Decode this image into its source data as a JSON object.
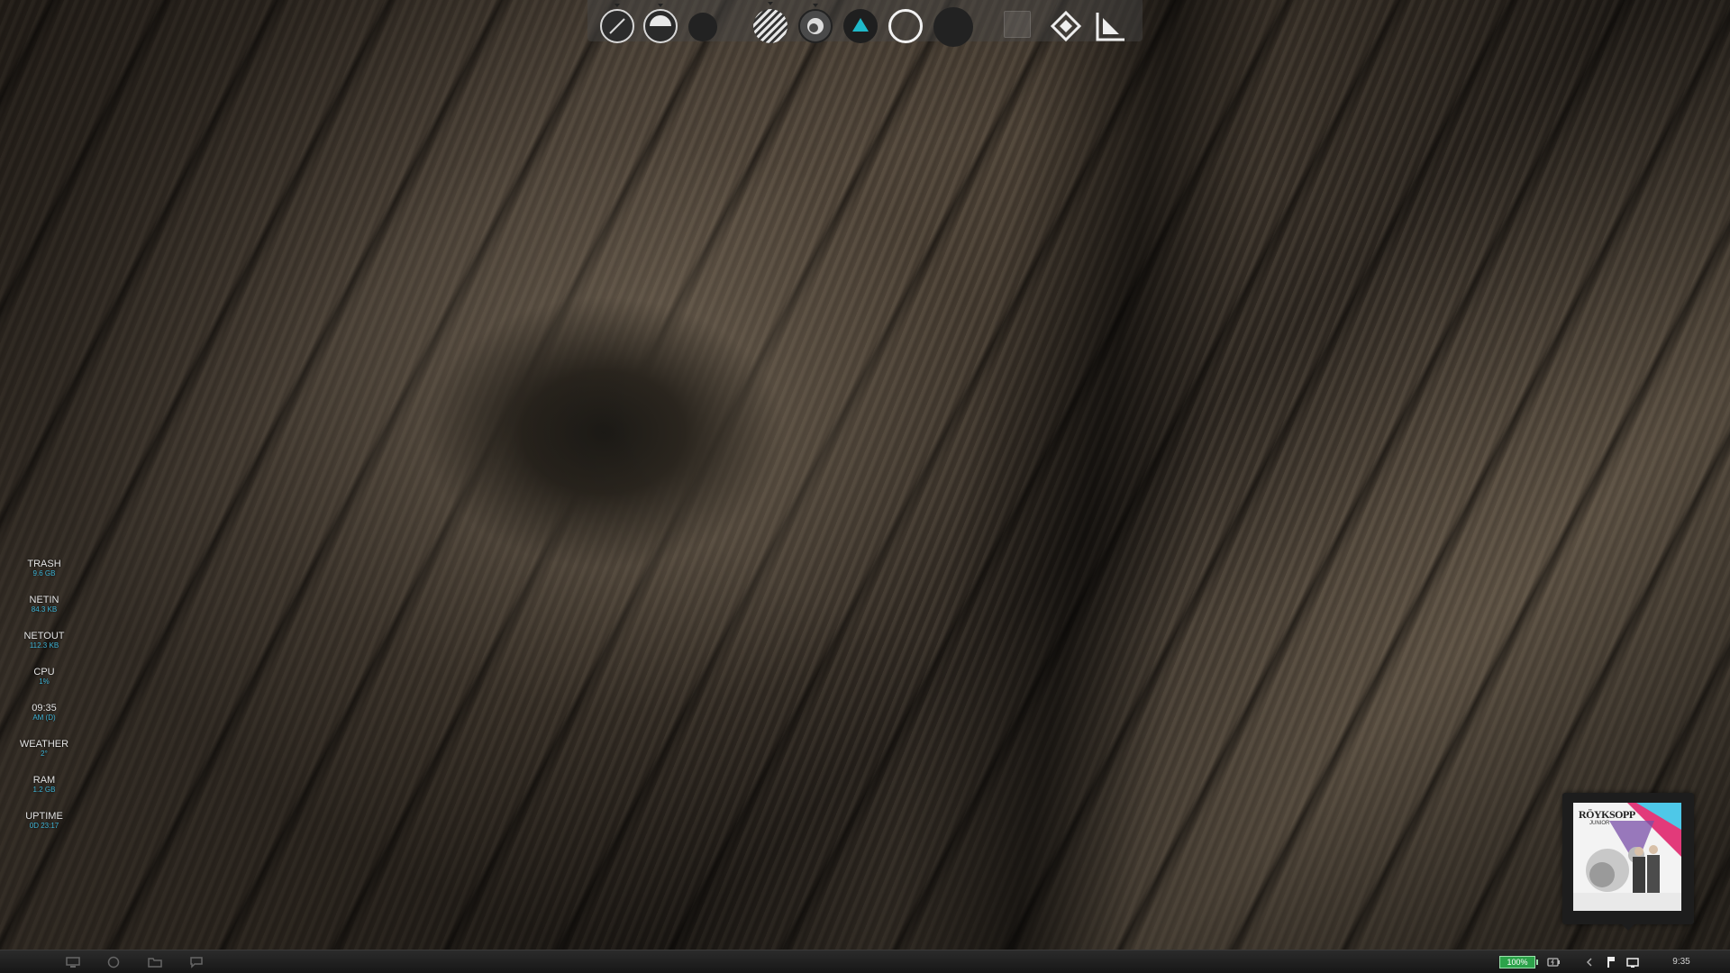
{
  "desktop": {
    "wallpaper": "weathered wood grain with knot"
  },
  "top_dock": {
    "icons": [
      {
        "name": "app-diagonal-slash-icon",
        "running": true
      },
      {
        "name": "app-half-circle-icon",
        "running": true
      },
      {
        "name": "app-dark-circle-icon",
        "running": false
      },
      {
        "name": "app-striped-circle-icon",
        "running": true
      },
      {
        "name": "app-aperture-icon",
        "running": true
      },
      {
        "name": "app-cyan-triangle-icon",
        "running": false
      },
      {
        "name": "app-white-ring-icon",
        "running": false
      },
      {
        "name": "app-dark-disc-icon",
        "running": false
      },
      {
        "name": "app-faded-square-icon",
        "running": false
      },
      {
        "name": "app-diamond-icon",
        "running": false
      },
      {
        "name": "app-corner-triangle-icon",
        "running": false
      }
    ],
    "accent": "#1fb9c9"
  },
  "widgets": [
    {
      "label": "TRASH",
      "value": "9.6 GB"
    },
    {
      "label": "NETIN",
      "value": "84.3 KB"
    },
    {
      "label": "NETOUT",
      "value": "112.3 KB"
    },
    {
      "label": "CPU",
      "value": "1%"
    },
    {
      "label": "09:35",
      "value": "AM (D)"
    },
    {
      "label": "WEATHER",
      "value": "2°"
    },
    {
      "label": "RAM",
      "value": "1.2 GB"
    },
    {
      "label": "UPTIME",
      "value": "0D 23:17"
    }
  ],
  "widget_value_color": "#3fb6d8",
  "album": {
    "title_text": "RÖYKSOPP",
    "subtitle_text": "JUNIOR"
  },
  "taskbar": {
    "launchers": [
      "computer-icon",
      "globe-icon",
      "folder-icon",
      "chat-icon"
    ],
    "battery": "100%",
    "battery_color": "#2ca24a",
    "tray_icons": [
      "battery-charging-icon",
      "chevron-left-icon",
      "network-flag-icon",
      "display-icon"
    ],
    "clock": "9:35"
  }
}
